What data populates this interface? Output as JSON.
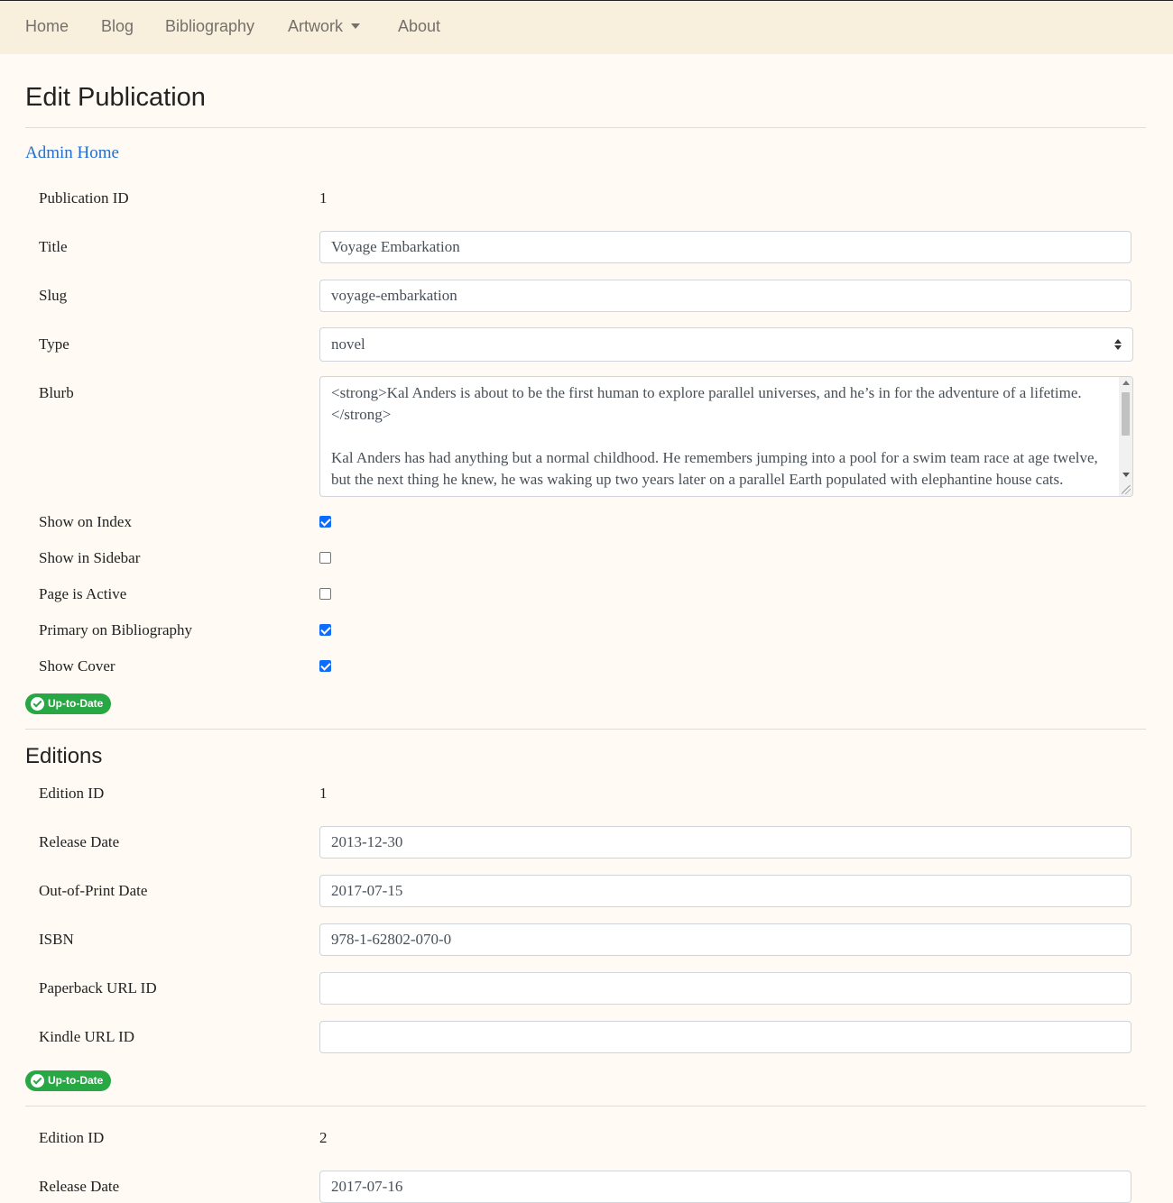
{
  "nav": {
    "home": "Home",
    "blog": "Blog",
    "bibliography": "Bibliography",
    "artwork": "Artwork",
    "about": "About"
  },
  "page": {
    "title": "Edit Publication",
    "admin_home": "Admin Home"
  },
  "publication": {
    "id_label": "Publication ID",
    "id_value": "1",
    "title_label": "Title",
    "title_value": "Voyage Embarkation",
    "slug_label": "Slug",
    "slug_value": "voyage-embarkation",
    "type_label": "Type",
    "type_value": "novel",
    "blurb_label": "Blurb",
    "blurb_value": "<strong>Kal Anders is about to be the first human to explore parallel universes, and he’s in for the adventure of a lifetime.</strong>\n\nKal Anders has had anything but a normal childhood. He remembers jumping into a pool for a swim team race at age twelve, but the next thing he knew, he was waking up two years later on a parallel Earth populated with elephantine house cats.",
    "checkboxes": [
      {
        "label": "Show on Index",
        "checked": true
      },
      {
        "label": "Show in Sidebar",
        "checked": false
      },
      {
        "label": "Page is Active",
        "checked": false
      },
      {
        "label": "Primary on Bibliography",
        "checked": true
      },
      {
        "label": "Show Cover",
        "checked": true
      }
    ],
    "status_badge": "Up-to-Date"
  },
  "editions_heading": "Editions",
  "editions": [
    {
      "id_label": "Edition ID",
      "id_value": "1",
      "release_label": "Release Date",
      "release_value": "2013-12-30",
      "oop_label": "Out-of-Print Date",
      "oop_value": "2017-07-15",
      "isbn_label": "ISBN",
      "isbn_value": "978-1-62802-070-0",
      "paperback_label": "Paperback URL ID",
      "paperback_value": "",
      "kindle_label": "Kindle URL ID",
      "kindle_value": "",
      "status_badge": "Up-to-Date"
    },
    {
      "id_label": "Edition ID",
      "id_value": "2",
      "release_label": "Release Date",
      "release_value": "2017-07-16"
    }
  ],
  "colors": {
    "background": "#fffaf3",
    "navbar": "#f8efdd",
    "link": "#1f6fd1",
    "badge": "#28a745",
    "checkbox": "#0d6efd"
  }
}
